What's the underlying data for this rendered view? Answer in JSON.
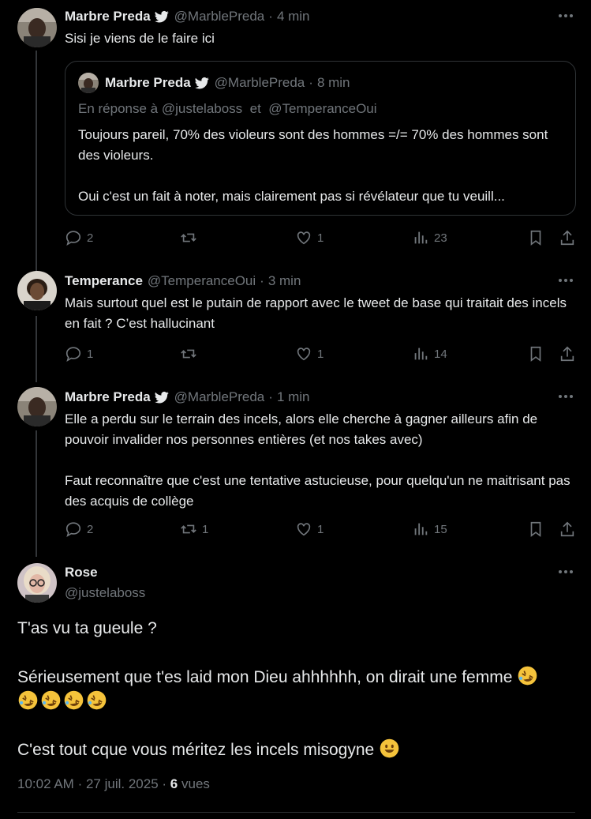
{
  "tweets": [
    {
      "name": "Marbre Preda",
      "handle": "@MarblePreda",
      "time": "4 min",
      "text": "Sisi je viens de le faire ici",
      "quote": {
        "name": "Marbre Preda",
        "handle": "@MarblePreda",
        "time": "8 min",
        "reply_prefix": "En réponse à",
        "reply_to_1": "@justelaboss",
        "reply_and": "et",
        "reply_to_2": "@TemperanceOui",
        "text": "Toujours pareil, 70% des violeurs sont des hommes =/= 70% des hommes sont des violeurs.\n\nOui c'est un fait à noter, mais clairement pas si révélateur que tu veuill..."
      },
      "replies": "2",
      "retweets": "",
      "likes": "1",
      "views": "23"
    },
    {
      "name": "Temperance",
      "handle": "@TemperanceOui",
      "time": "3 min",
      "text": "Mais surtout quel est le putain de rapport avec le tweet de base qui traitait des incels en fait ? C’est hallucinant",
      "replies": "1",
      "retweets": "",
      "likes": "1",
      "views": "14"
    },
    {
      "name": "Marbre Preda",
      "handle": "@MarblePreda",
      "time": "1 min",
      "text": "Elle a perdu sur le terrain des incels, alors elle cherche à gagner ailleurs afin de pouvoir invalider nos personnes entières (et nos takes avec)\n\nFaut reconnaître que c'est une tentative astucieuse, pour quelqu'un ne maitrisant pas des acquis de collège",
      "replies": "2",
      "retweets": "1",
      "likes": "1",
      "views": "15"
    }
  ],
  "main": {
    "name": "Rose",
    "handle": "@justelaboss",
    "line1": "T'as vu ta gueule ?",
    "line2": "Sérieusement que t'es laid mon Dieu ahhhhhh, on dirait une femme",
    "line3": "C'est tout cque vous méritez les incels misogyne",
    "time": "10:02 AM",
    "date": "27 juil. 2025",
    "views_count": "6",
    "views_label": "vues"
  },
  "separator": "·",
  "colors": {
    "background": "#000000",
    "text": "#e7e9ea",
    "muted": "#71767b",
    "border": "#2f3336",
    "verified": "#1d9bf0"
  },
  "icons": [
    "twitter-bird-icon",
    "more-icon",
    "reply-icon",
    "retweet-icon",
    "like-icon",
    "views-icon",
    "bookmark-icon",
    "share-icon",
    "rolling-laughing-emoji",
    "smile-emoji"
  ]
}
